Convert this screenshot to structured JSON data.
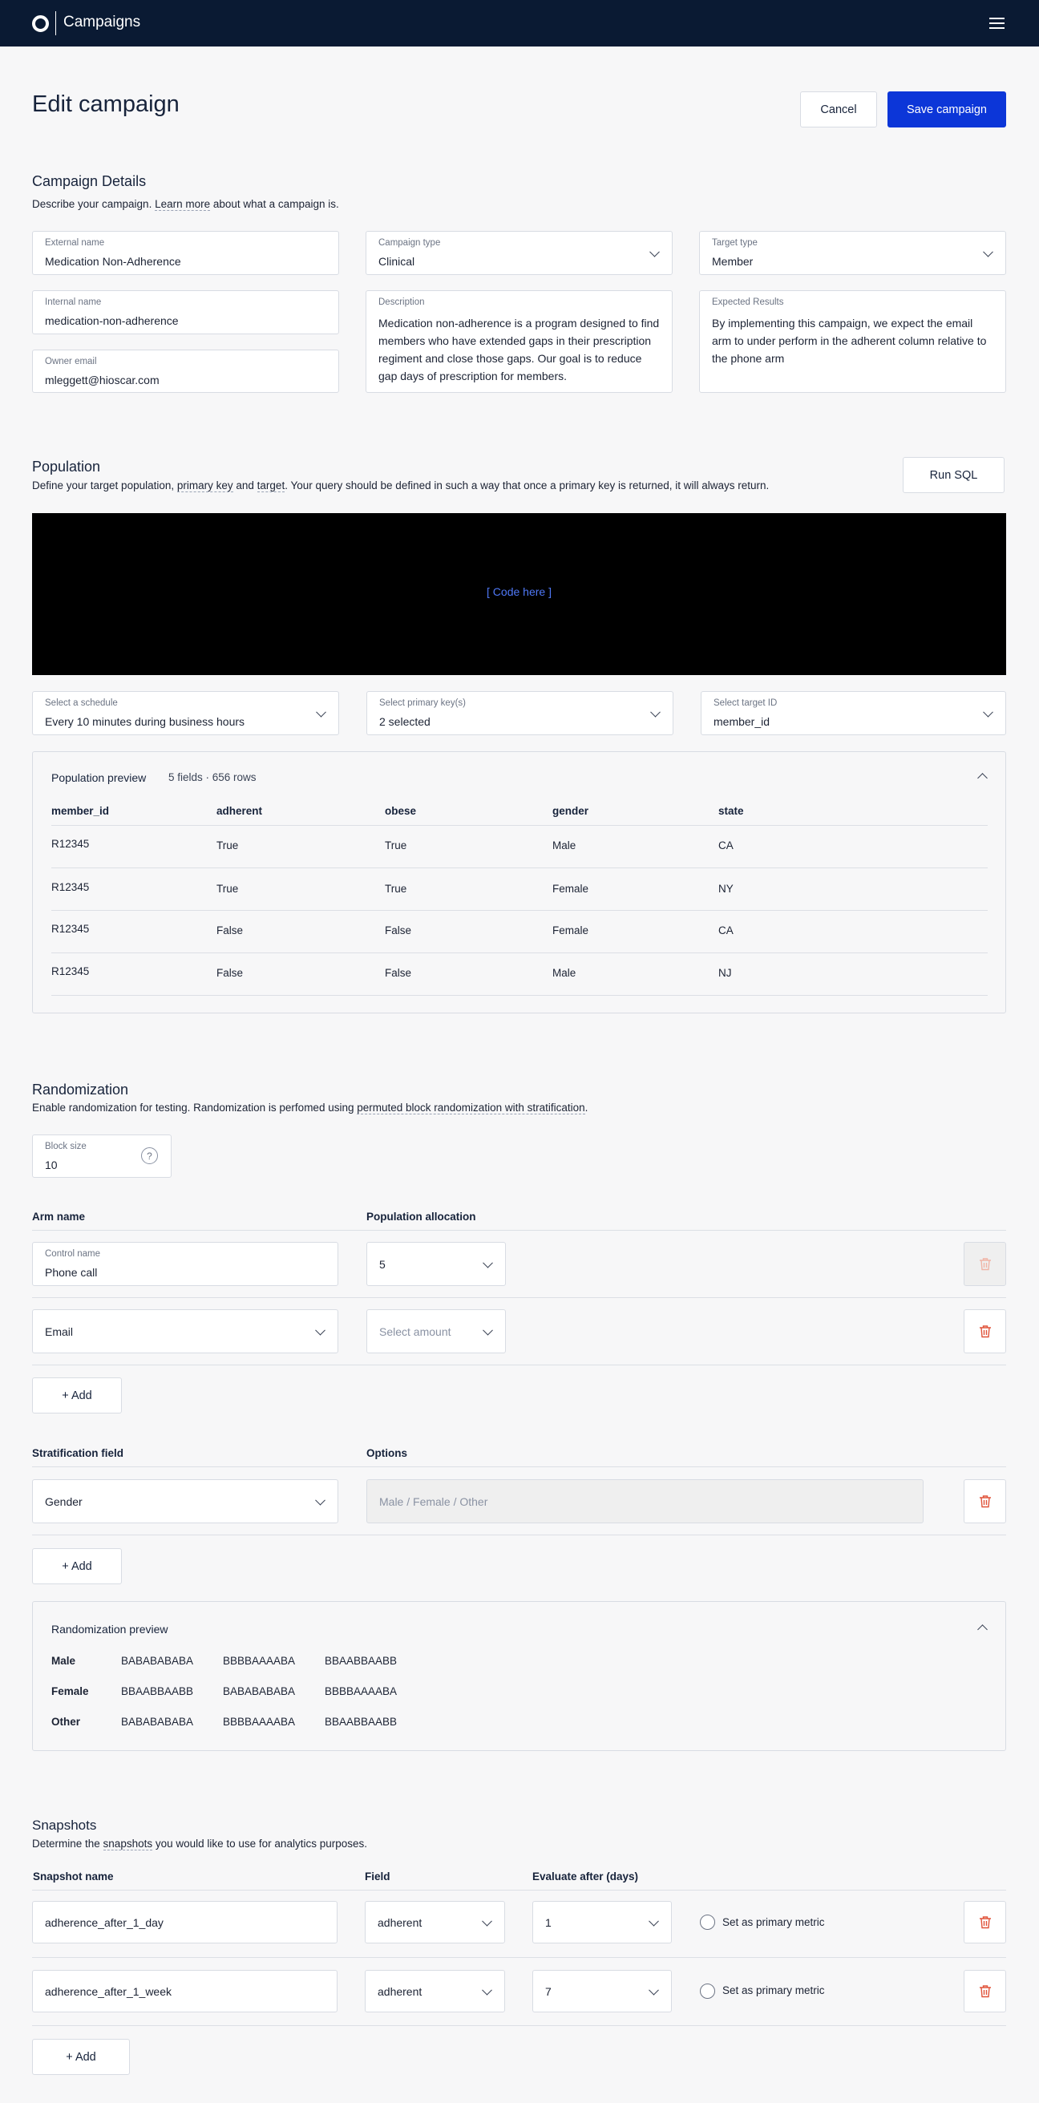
{
  "header": {
    "app_title": "Campaigns"
  },
  "page": {
    "title": "Edit campaign",
    "cancel_label": "Cancel",
    "save_label": "Save campaign"
  },
  "details": {
    "title": "Campaign Details",
    "desc_prefix": "Describe your campaign. ",
    "desc_link": "Learn more",
    "desc_suffix": " about what a campaign is.",
    "external_name": {
      "label": "External name",
      "value": "Medication Non-Adherence"
    },
    "campaign_type": {
      "label": "Campaign type",
      "value": "Clinical"
    },
    "target_type": {
      "label": "Target type",
      "value": "Member"
    },
    "internal_name": {
      "label": "Internal name",
      "value": "medication-non-adherence"
    },
    "description": {
      "label": "Description",
      "value": "Medication non-adherence is a program designed to find members who have extended gaps in their prescription regiment and close those gaps. Our goal is to reduce gap days of prescription for members."
    },
    "expected_results": {
      "label": "Expected Results",
      "value": "By implementing this campaign, we expect the email arm to under perform in the adherent column relative to the phone arm"
    },
    "owner_email": {
      "label": "Owner email",
      "value": "mleggett@hioscar.com"
    }
  },
  "population": {
    "title": "Population",
    "desc_1": "Define your target population, ",
    "desc_link_1": "primary key",
    "desc_2": " and ",
    "desc_link_2": "target",
    "desc_3": ". Your query should be defined in such a way that once a primary key is returned, it will always return.",
    "run_sql_label": "Run SQL",
    "code_placeholder": "[ Code here ]",
    "schedule": {
      "label": "Select a schedule",
      "value": "Every 10 minutes during business hours"
    },
    "primary_keys": {
      "label": "Select primary key(s)",
      "value": "2 selected"
    },
    "target_id": {
      "label": "Select target ID",
      "value": "member_id"
    },
    "preview": {
      "title": "Population preview",
      "meta": "5 fields · 656 rows",
      "columns": [
        "member_id",
        "adherent",
        "obese",
        "gender",
        "state"
      ],
      "rows": [
        [
          "R12345",
          "True",
          "True",
          "Male",
          "CA"
        ],
        [
          "R12345",
          "True",
          "True",
          "Female",
          "NY"
        ],
        [
          "R12345",
          "False",
          "False",
          "Female",
          "CA"
        ],
        [
          "R12345",
          "False",
          "False",
          "Male",
          "NJ"
        ]
      ]
    }
  },
  "randomization": {
    "title": "Randomization",
    "desc_1": "Enable randomization for testing. Randomization is perfomed using ",
    "desc_link": "permuted block randomization with stratification",
    "desc_2": ".",
    "block_size": {
      "label": "Block size",
      "value": "10",
      "help": "?"
    },
    "arm_header": "Arm name",
    "allocation_header": "Population allocation",
    "arms": [
      {
        "label": "Control name",
        "value": "Phone call",
        "allocation": "5"
      },
      {
        "value": "Email",
        "allocation_placeholder": "Select amount"
      }
    ],
    "add_label": "+ Add",
    "strat_header": "Stratification field",
    "options_header": "Options",
    "strat_field": "Gender",
    "strat_options": "Male / Female / Other",
    "add_label_2": "+ Add",
    "preview": {
      "title": "Randomization preview",
      "rows": [
        {
          "label": "Male",
          "values": [
            "BABABABABA",
            "BBBBAAAABA",
            "BBAABBAABB"
          ]
        },
        {
          "label": "Female",
          "values": [
            "BBAABBAABB",
            "BABABABABA",
            "BBBBAAAABA"
          ]
        },
        {
          "label": "Other",
          "values": [
            "BABABABABA",
            "BBBBAAAABA",
            "BBAABBAABB"
          ]
        }
      ]
    }
  },
  "snapshots": {
    "title": "Snapshots",
    "desc_1": "Determine the ",
    "desc_link": "snapshots",
    "desc_2": " you would like to use for analytics purposes.",
    "col_name": "Snapshot name",
    "col_field": "Field",
    "col_eval": "Evaluate after (days)",
    "rows": [
      {
        "name": "adherence_after_1_day",
        "field": "adherent",
        "days": "1",
        "metric_label": "Set as primary metric"
      },
      {
        "name": "adherence_after_1_week",
        "field": "adherent",
        "days": "7",
        "metric_label": "Set as primary metric"
      }
    ],
    "add_label": "+ Add"
  },
  "colors": {
    "navbar": "#0a1a33",
    "primary": "#0c36d8",
    "danger": "#e0533a",
    "danger_muted": "#f0b4a6"
  }
}
